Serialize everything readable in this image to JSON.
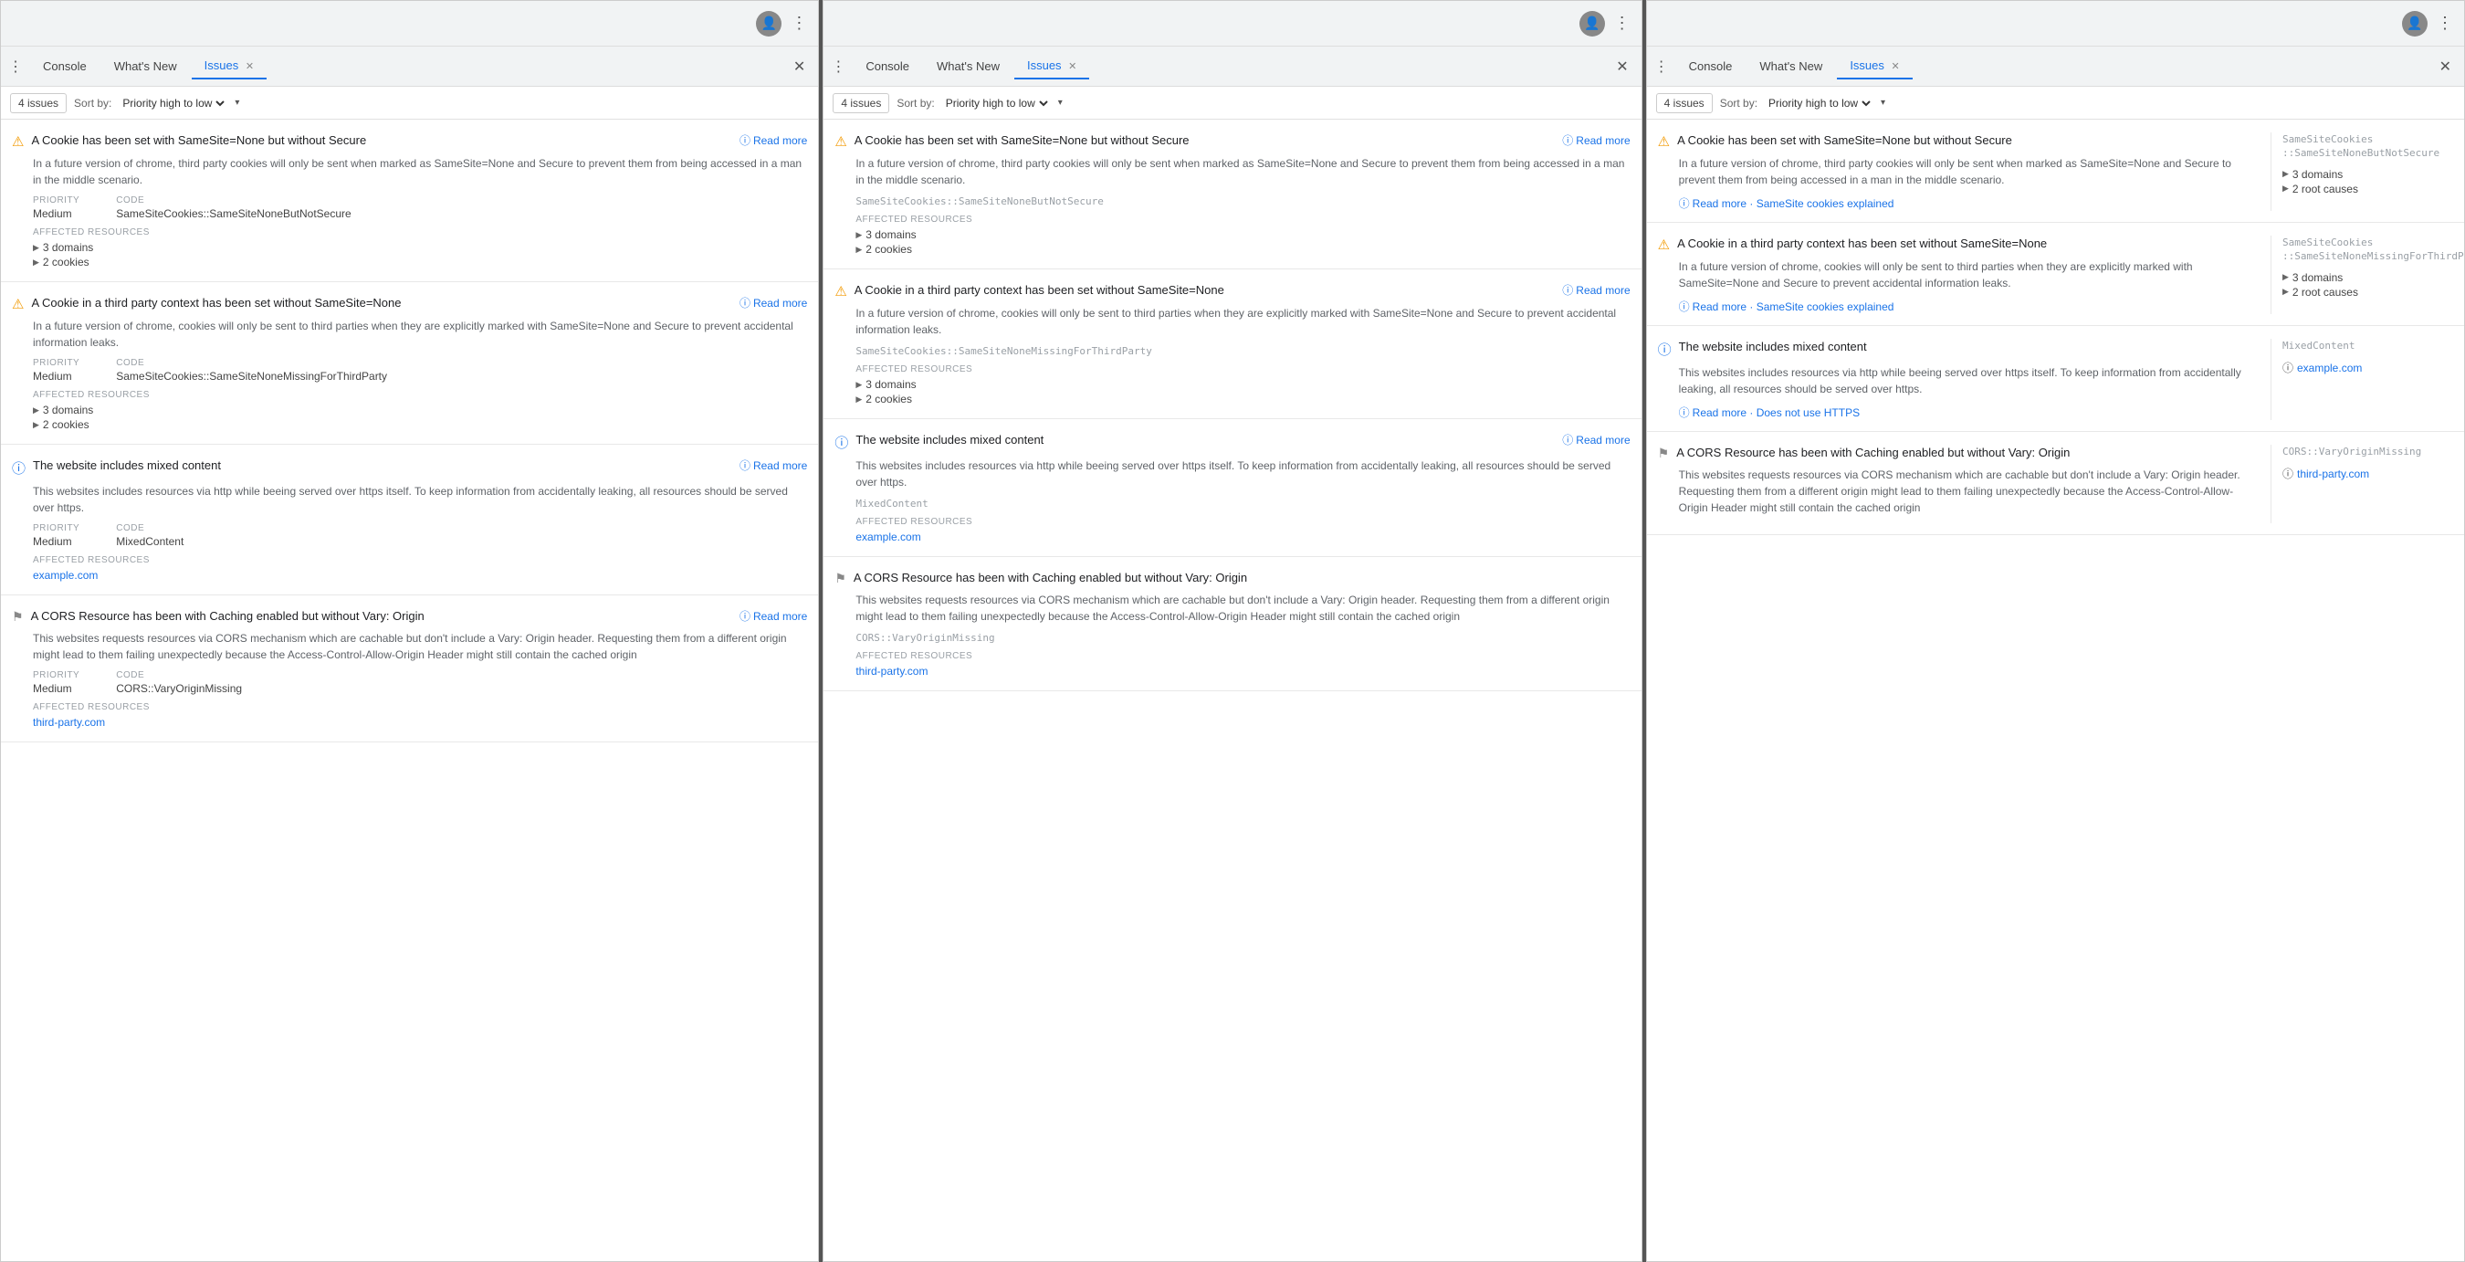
{
  "panels": [
    {
      "id": "panel1",
      "browser": {
        "avatar": "👤",
        "dots": "⋮"
      },
      "devtools": {
        "dots": "⋮",
        "tabs": [
          {
            "label": "Console",
            "active": false
          },
          {
            "label": "What's New",
            "active": false
          },
          {
            "label": "Issues",
            "active": true,
            "closeable": true
          }
        ],
        "close": "✕"
      },
      "filter": {
        "count": "4 issues",
        "sort_label": "Sort by:",
        "sort_value": "Priority high to low"
      },
      "issues": [
        {
          "icon": "warning",
          "title": "A Cookie has been set with SameSite=None but without Secure",
          "read_more": "Read more",
          "desc": "In a future version of chrome, third party cookies will only be sent when marked as SameSite=None and Secure to prevent them from being accessed in a man in the middle scenario.",
          "priority_label": "PRIORITY",
          "priority_value": "Medium",
          "code_label": "CODE",
          "code_value": "SameSiteCookies::SameSiteNoneButNotSecure",
          "affected_label": "AFFECTED RESOURCES",
          "resources": [
            "3 domains",
            "2 cookies"
          ]
        },
        {
          "icon": "warning",
          "title": "A Cookie in a third party context has been set without SameSite=None",
          "read_more": "Read more",
          "desc": "In a future version of chrome, cookies will only be sent to third parties when they are explicitly marked with SameSite=None and Secure to prevent accidental information leaks.",
          "priority_label": "PRIORITY",
          "priority_value": "Medium",
          "code_label": "CODE",
          "code_value": "SameSiteCookies::SameSiteNoneMissingForThirdParty",
          "affected_label": "AFFECTED RESOURCES",
          "resources": [
            "3 domains",
            "2 cookies"
          ]
        },
        {
          "icon": "info",
          "title": "The website includes mixed content",
          "read_more": "Read more",
          "desc": "This websites includes resources via http while beeing served over https itself. To keep information from accidentally leaking, all resources should be served over https.",
          "priority_label": "PRIORITY",
          "priority_value": "Medium",
          "code_label": "CODE",
          "code_value": "MixedContent",
          "affected_label": "AFFECTED RESOURCES",
          "resources_links": [
            "example.com"
          ]
        },
        {
          "icon": "flag",
          "title": "A CORS Resource has been with Caching enabled but without Vary: Origin",
          "read_more": "Read more",
          "desc": "This websites requests resources via CORS mechanism which are cachable but don't include a Vary: Origin header. Requesting them from a different origin might lead to them failing unexpectedly because the Access-Control-Allow-Origin Header might still contain the cached origin",
          "priority_label": "PRIORITY",
          "priority_value": "Medium",
          "code_label": "CODE",
          "code_value": "CORS::VaryOriginMissing",
          "affected_label": "AFFECTED RESOURCES",
          "resources_links": [
            "third-party.com"
          ]
        }
      ]
    },
    {
      "id": "panel2",
      "browser": {
        "avatar": "👤",
        "dots": "⋮"
      },
      "devtools": {
        "dots": "⋮",
        "tabs": [
          {
            "label": "Console",
            "active": false
          },
          {
            "label": "What's New",
            "active": false
          },
          {
            "label": "Issues",
            "active": true,
            "closeable": true
          }
        ],
        "close": "✕"
      },
      "filter": {
        "count": "4 issues",
        "sort_label": "Sort by:",
        "sort_value": "Priority high to low"
      },
      "issues": [
        {
          "icon": "warning",
          "title": "A Cookie has been set with SameSite=None but without Secure",
          "read_more": "Read more",
          "desc": "In a future version of chrome, third party cookies will only be sent when marked as SameSite=None and Secure to prevent them from being accessed in a man in the middle scenario.",
          "code_value": "SameSiteCookies::SameSiteNoneButNotSecure",
          "affected_label": "AFFECTED RESOURCES",
          "resources": [
            "3 domains",
            "2 cookies"
          ]
        },
        {
          "icon": "warning",
          "title": "A Cookie in a third party context has been set without SameSite=None",
          "read_more": "Read more",
          "desc": "In a future version of chrome, cookies will only be sent to third parties when they are explicitly marked with SameSite=None and Secure to prevent accidental information leaks.",
          "code_value": "SameSiteCookies::SameSiteNoneMissingForThirdParty",
          "affected_label": "AFFECTED RESOURCES",
          "resources": [
            "3 domains",
            "2 cookies"
          ]
        },
        {
          "icon": "info",
          "title": "The website includes mixed content",
          "read_more": "Read more",
          "desc": "This websites includes resources via http while beeing served over https itself. To keep information from accidentally leaking, all resources should be served over https.",
          "code_value": "MixedContent",
          "affected_label": "AFFECTED RESOURCES",
          "resources_links": [
            "example.com"
          ]
        },
        {
          "icon": "flag",
          "title": "A CORS Resource has been with Caching enabled but without Vary: Origin",
          "desc": "This websites requests resources via CORS mechanism which are cachable but don't include a Vary: Origin header. Requesting them from a different origin might lead to them failing unexpectedly because the Access-Control-Allow-Origin Header might still contain the cached origin",
          "affected_label": "AFFECTED RESOURCES",
          "resources_links": [
            "third-party.com"
          ]
        }
      ]
    },
    {
      "id": "panel3",
      "browser": {
        "avatar": "👤",
        "dots": "⋮"
      },
      "devtools": {
        "dots": "⋮",
        "tabs": [
          {
            "label": "Console",
            "active": false
          },
          {
            "label": "What's New",
            "active": false
          },
          {
            "label": "Issues",
            "active": true,
            "closeable": true
          }
        ],
        "close": "✕"
      },
      "filter": {
        "count": "4 issues",
        "sort_label": "Sort by:",
        "sort_value": "Priority high to low"
      },
      "issues": [
        {
          "icon": "warning",
          "title": "A Cookie has been set with SameSite=None but without Secure",
          "desc": "In a future version of chrome, third party cookies will only be sent when marked as SameSite=None and Secure to prevent them from being accessed in a man in the middle scenario.",
          "read_more_link": "Read more · SameSite cookies explained",
          "sidebar_code": "SameSiteCookies\n::SameSiteNoneButNotSecure",
          "sidebar_stats": [
            "3 domains",
            "2 root causes"
          ]
        },
        {
          "icon": "warning",
          "title": "A Cookie in a third party context has been set without SameSite=None",
          "desc": "In a future version of chrome, cookies will only be sent to third parties when they are explicitly marked with SameSite=None and Secure to prevent accidental information leaks.",
          "read_more_link": "Read more · SameSite cookies explained",
          "sidebar_code": "SameSiteCookies\n::SameSiteNoneMissingForThirdParty",
          "sidebar_stats": [
            "3 domains",
            "2 root causes"
          ]
        },
        {
          "icon": "info",
          "title": "The website includes mixed content",
          "desc": "This websites includes resources via http while beeing served over https itself. To keep information from accidentally leaking, all resources should be served over https.",
          "read_more_link": "Read more · Does not use HTTPS",
          "sidebar_code": "MixedContent",
          "sidebar_links": [
            "example.com"
          ]
        },
        {
          "icon": "flag",
          "title": "A CORS Resource has been with Caching enabled but without Vary: Origin",
          "desc": "This websites requests resources via CORS mechanism which are cachable but don't include a Vary: Origin header. Requesting them from a different origin might lead to them failing unexpectedly because the Access-Control-Allow-Origin Header might still contain the cached origin",
          "sidebar_code": "CORS::VaryOriginMissing",
          "sidebar_links": [
            "third-party.com"
          ]
        }
      ]
    }
  ],
  "labels": {
    "read_more": "Read more",
    "priority": "PRIORITY",
    "code": "CODE",
    "affected": "AFFECTED RESOURCES",
    "sort_by": "Sort by:"
  }
}
